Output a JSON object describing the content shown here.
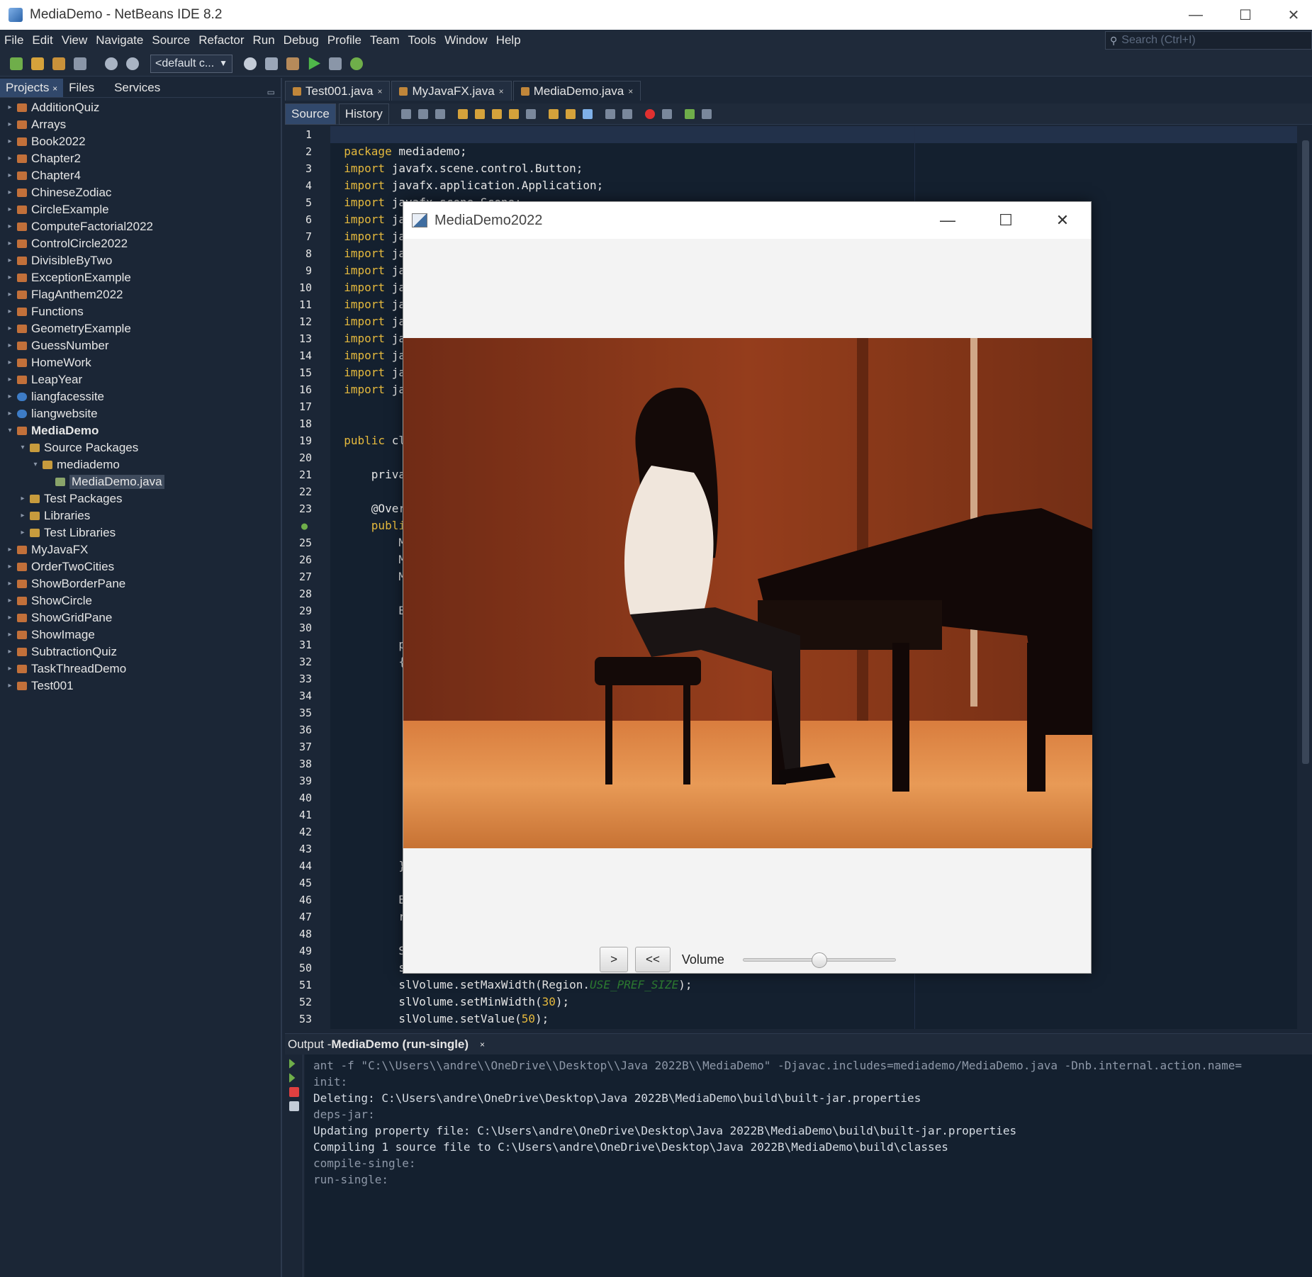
{
  "window": {
    "title": "MediaDemo - NetBeans IDE 8.2",
    "minimize_glyph": "—",
    "maximize_glyph": "☐",
    "close_glyph": "✕"
  },
  "menu": [
    "File",
    "Edit",
    "View",
    "Navigate",
    "Source",
    "Refactor",
    "Run",
    "Debug",
    "Profile",
    "Team",
    "Tools",
    "Window",
    "Help"
  ],
  "search": {
    "placeholder": "Search (Ctrl+I)"
  },
  "toolbar": {
    "config_value": "<default c..."
  },
  "left_panel": {
    "tabs": [
      "Projects",
      "Files",
      "Services"
    ],
    "tab_close": "×",
    "tree": [
      {
        "label": "AdditionQuiz",
        "level": 0,
        "icon": "project"
      },
      {
        "label": "Arrays",
        "level": 0,
        "icon": "project"
      },
      {
        "label": "Book2022",
        "level": 0,
        "icon": "project"
      },
      {
        "label": "Chapter2",
        "level": 0,
        "icon": "project"
      },
      {
        "label": "Chapter4",
        "level": 0,
        "icon": "project"
      },
      {
        "label": "ChineseZodiac",
        "level": 0,
        "icon": "project"
      },
      {
        "label": "CircleExample",
        "level": 0,
        "icon": "project"
      },
      {
        "label": "ComputeFactorial2022",
        "level": 0,
        "icon": "project"
      },
      {
        "label": "ControlCircle2022",
        "level": 0,
        "icon": "project"
      },
      {
        "label": "DivisibleByTwo",
        "level": 0,
        "icon": "project"
      },
      {
        "label": "ExceptionExample",
        "level": 0,
        "icon": "project"
      },
      {
        "label": "FlagAnthem2022",
        "level": 0,
        "icon": "project"
      },
      {
        "label": "Functions",
        "level": 0,
        "icon": "project"
      },
      {
        "label": "GeometryExample",
        "level": 0,
        "icon": "project"
      },
      {
        "label": "GuessNumber",
        "level": 0,
        "icon": "project"
      },
      {
        "label": "HomeWork",
        "level": 0,
        "icon": "project"
      },
      {
        "label": "LeapYear",
        "level": 0,
        "icon": "project"
      },
      {
        "label": "liangfacessite",
        "level": 0,
        "icon": "web"
      },
      {
        "label": "liangwebsite",
        "level": 0,
        "icon": "web"
      },
      {
        "label": "MediaDemo",
        "level": 0,
        "icon": "project",
        "bold": true,
        "expanded": true
      },
      {
        "label": "Source Packages",
        "level": 1,
        "icon": "pkg",
        "expanded": true
      },
      {
        "label": "mediademo",
        "level": 2,
        "icon": "pkg",
        "expanded": true
      },
      {
        "label": "MediaDemo.java",
        "level": 3,
        "icon": "file",
        "selected": true
      },
      {
        "label": "Test Packages",
        "level": 1,
        "icon": "pkg"
      },
      {
        "label": "Libraries",
        "level": 1,
        "icon": "pkg"
      },
      {
        "label": "Test Libraries",
        "level": 1,
        "icon": "pkg"
      },
      {
        "label": "MyJavaFX",
        "level": 0,
        "icon": "project"
      },
      {
        "label": "OrderTwoCities",
        "level": 0,
        "icon": "project"
      },
      {
        "label": "ShowBorderPane",
        "level": 0,
        "icon": "project"
      },
      {
        "label": "ShowCircle",
        "level": 0,
        "icon": "project"
      },
      {
        "label": "ShowGridPane",
        "level": 0,
        "icon": "project"
      },
      {
        "label": "ShowImage",
        "level": 0,
        "icon": "project"
      },
      {
        "label": "SubtractionQuiz",
        "level": 0,
        "icon": "project"
      },
      {
        "label": "TaskThreadDemo",
        "level": 0,
        "icon": "project"
      },
      {
        "label": "Test001",
        "level": 0,
        "icon": "project"
      }
    ]
  },
  "editor": {
    "tabs": [
      {
        "label": "Test001.java",
        "active": false
      },
      {
        "label": "MyJavaFX.java",
        "active": false
      },
      {
        "label": "MediaDemo.java",
        "active": true
      }
    ],
    "tab_close": "×",
    "view_tabs": [
      "Source",
      "History"
    ],
    "lines": [
      "",
      "package mediademo;",
      "import javafx.scene.control.Button;",
      "import javafx.application.Application;",
      "import javafx.scene.Scene;",
      "import jav",
      "import jav",
      "import jav",
      "import jav",
      "import jav",
      "import jav",
      "import jav",
      "import jav",
      "import jav",
      "import jav",
      "import jav",
      "",
      "",
      "public cla",
      "",
      "    privat",
      "",
      "    @Overr",
      "    public",
      "        Me",
      "        Me",
      "        Me",
      "",
      "        Bu",
      "",
      "        pl",
      "        {",
      "",
      "",
      "",
      "",
      "",
      "",
      "",
      "",
      "",
      "",
      "",
      "        })",
      "",
      "        Bu",
      "        re",
      "",
      "        Sl",
      "        sl",
      "        slVolume.setMaxWidth(Region.USE_PREF_SIZE);",
      "        slVolume.setMinWidth(30);",
      "        slVolume.setValue(50);"
    ]
  },
  "output": {
    "title_prefix": "Output - ",
    "title_main": "MediaDemo (run-single)",
    "close": "×",
    "lines": [
      {
        "text": "ant -f \"C:\\\\Users\\\\andre\\\\OneDrive\\\\Desktop\\\\Java 2022B\\\\MediaDemo\" -Djavac.includes=mediademo/MediaDemo.java -Dnb.internal.action.name=",
        "dim": true
      },
      {
        "text": "init:",
        "dim": true
      },
      {
        "text": "Deleting: C:\\Users\\andre\\OneDrive\\Desktop\\Java 2022B\\MediaDemo\\build\\built-jar.properties",
        "dim": false
      },
      {
        "text": "deps-jar:",
        "dim": true
      },
      {
        "text": "Updating property file: C:\\Users\\andre\\OneDrive\\Desktop\\Java 2022B\\MediaDemo\\build\\built-jar.properties",
        "dim": false
      },
      {
        "text": "Compiling 1 source file to C:\\Users\\andre\\OneDrive\\Desktop\\Java 2022B\\MediaDemo\\build\\classes",
        "dim": false
      },
      {
        "text": "compile-single:",
        "dim": true
      },
      {
        "text": "run-single:",
        "dim": true
      }
    ]
  },
  "media_window": {
    "title": "MediaDemo2022",
    "play_label": ">",
    "rewind_label": "<<",
    "volume_label": "Volume",
    "volume_value": 50
  },
  "colors": {
    "ide_bg": "#1b2636",
    "editor_bg": "#14202f",
    "keyword": "#e5b93d",
    "constant": "#2e7d32"
  }
}
